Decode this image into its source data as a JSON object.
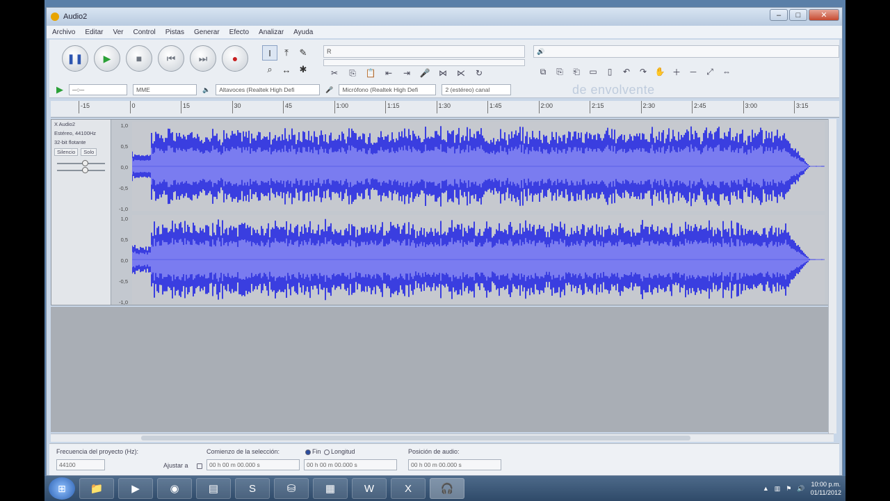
{
  "window": {
    "title": "Audio2",
    "controls": [
      "–",
      "□",
      "✕"
    ]
  },
  "menu": [
    "Archivo",
    "Editar",
    "Ver",
    "Control",
    "Pistas",
    "Generar",
    "Efecto",
    "Analizar",
    "Ayuda"
  ],
  "transport": [
    {
      "name": "pause-button",
      "glyph": "❚❚",
      "cls": "pause"
    },
    {
      "name": "play-button",
      "glyph": "▶",
      "cls": "play"
    },
    {
      "name": "stop-button",
      "glyph": "■",
      "cls": "stop"
    },
    {
      "name": "skip-start-button",
      "glyph": "⏮",
      "cls": "skip"
    },
    {
      "name": "skip-end-button",
      "glyph": "⏭",
      "cls": "skip"
    },
    {
      "name": "record-button",
      "glyph": "●",
      "cls": "record"
    }
  ],
  "tools": [
    {
      "name": "selection-tool-icon",
      "glyph": "I",
      "active": true
    },
    {
      "name": "envelope-tool-icon",
      "glyph": "⤒",
      "active": false
    },
    {
      "name": "draw-tool-icon",
      "glyph": "✎",
      "active": false
    },
    {
      "name": "zoom-tool-icon",
      "glyph": "⌕",
      "active": false
    },
    {
      "name": "timeshift-tool-icon",
      "glyph": "↔",
      "active": false
    },
    {
      "name": "multi-tool-icon",
      "glyph": "✱",
      "active": false
    }
  ],
  "devicebar": {
    "host": "MME",
    "output": "Altavoces (Realtek High Defi",
    "input": "Micrófono (Realtek High Defi",
    "channels": "2 (estéreo) canal"
  },
  "overlay_text": "de envolvente",
  "ruler_ticks": [
    "-15",
    "0",
    "15",
    "30",
    "45",
    "1:00",
    "1:15",
    "1:30",
    "1:45",
    "2:00",
    "2:15",
    "2:30",
    "2:45",
    "3:00",
    "3:15"
  ],
  "track": {
    "name": "X  Audio2",
    "info1": "Estéreo, 44100Hz",
    "info2": "32-bit flotante",
    "mute": "Silencio",
    "solo": "Solo",
    "scale": [
      "1,0",
      "0,5",
      "0,0",
      "-0,5",
      "-1,0"
    ]
  },
  "selection_bar": {
    "rate_label": "Frecuencia del proyecto (Hz):",
    "rate_value": "44100",
    "snap_label": "Ajustar a",
    "start_label": "Comienzo de la selección:",
    "end_label": "Fin",
    "length_label": "Longitud",
    "position_label": "Posición de audio:",
    "time1": "00 h 00 m 00.000 s",
    "time2": "00 h 00 m 00.000 s",
    "time3": "00 h 00 m 00.000 s"
  },
  "clock": {
    "time": "10:00 p.m.",
    "date": "01/11/2012"
  },
  "colors": {
    "waveform": "#3a3ee0",
    "waveform_rms": "#7a7cf0",
    "wave_bg": "#c6c9cf"
  }
}
